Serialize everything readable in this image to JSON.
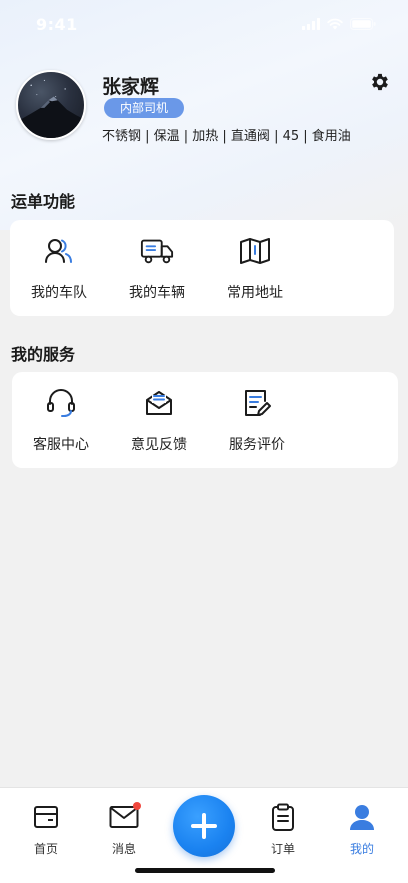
{
  "status_bar": {
    "time": "9:41"
  },
  "profile": {
    "name": "张家辉",
    "role": "内部司机",
    "tags": "不锈钢 | 保温 | 加热 | 直通阀 | 45 | 食用油"
  },
  "waybill": {
    "title": "运单功能",
    "items": [
      {
        "label": "我的车队",
        "icon": "fleet-icon"
      },
      {
        "label": "我的车辆",
        "icon": "truck-icon"
      },
      {
        "label": "常用地址",
        "icon": "map-icon"
      }
    ]
  },
  "services": {
    "title": "我的服务",
    "items": [
      {
        "label": "客服中心",
        "icon": "headset-icon"
      },
      {
        "label": "意见反馈",
        "icon": "feedback-icon"
      },
      {
        "label": "服务评价",
        "icon": "evaluation-icon"
      }
    ]
  },
  "tabbar": {
    "items": [
      {
        "label": "首页",
        "icon": "home-icon"
      },
      {
        "label": "消息",
        "icon": "mail-icon",
        "has_badge": true
      },
      {
        "label": "订单",
        "icon": "clipboard-icon"
      },
      {
        "label": "我的",
        "icon": "user-icon",
        "active": true
      }
    ],
    "fab_icon": "plus-icon"
  },
  "colors": {
    "accent": "#3a7de0",
    "badge_bg": "#6a98e8",
    "fab": "#1a82f0",
    "notification_dot": "#f0463c"
  }
}
